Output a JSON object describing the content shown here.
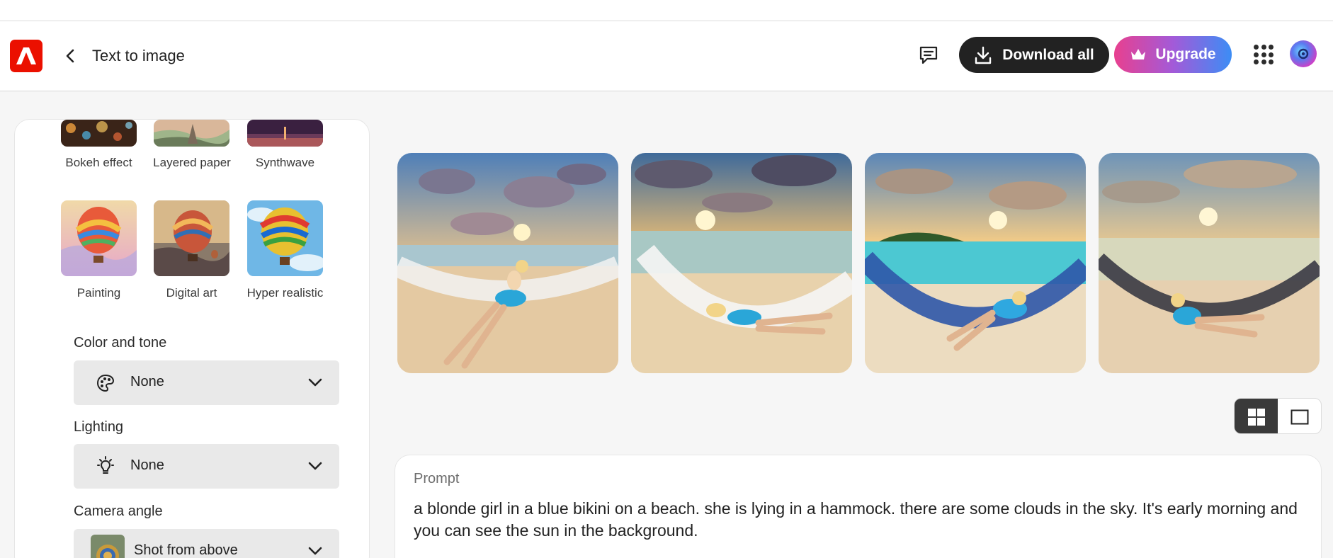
{
  "header": {
    "title": "Text to image",
    "download_label": "Download all",
    "upgrade_label": "Upgrade",
    "logo_icon": "adobe-logo-icon",
    "feedback_icon": "comment-icon",
    "apps_icon": "apps-grid-icon"
  },
  "styles": {
    "effects_row1": [
      {
        "label": "Bokeh effect"
      },
      {
        "label": "Layered paper"
      },
      {
        "label": "Synthwave"
      }
    ],
    "effects_row2": [
      {
        "label": "Painting"
      },
      {
        "label": "Digital art"
      },
      {
        "label": "Hyper realistic"
      }
    ]
  },
  "controls": {
    "color_tone": {
      "label": "Color and tone",
      "value": "None",
      "icon": "palette-icon"
    },
    "lighting": {
      "label": "Lighting",
      "value": "None",
      "icon": "lightbulb-icon"
    },
    "camera_angle": {
      "label": "Camera angle",
      "value": "Shot from above",
      "icon": "thumbnail"
    }
  },
  "results": {
    "count": 4
  },
  "view_toggle": {
    "options": [
      "grid",
      "single"
    ],
    "selected": "grid"
  },
  "prompt": {
    "label": "Prompt",
    "text": "a blonde girl in a blue bikini on a beach. she is lying in a hammock. there are some clouds in the sky. It's early morning and you can see the sun in the background."
  },
  "colors": {
    "accent_red": "#eb1000",
    "download_bg": "#222222",
    "upgrade_gradient": [
      "#e8408f",
      "#a35ad8",
      "#3c8df5"
    ]
  }
}
